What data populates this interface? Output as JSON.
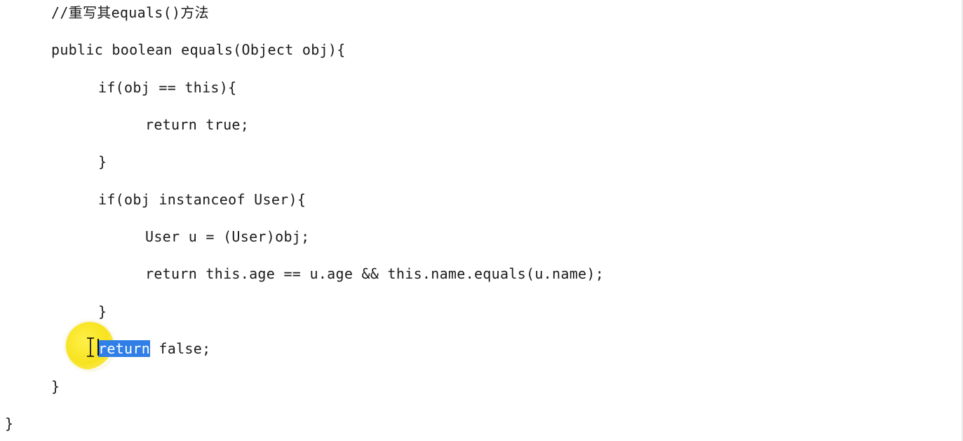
{
  "editor": {
    "lines": [
      {
        "id": "comment",
        "text": "//重写其equals()方法"
      },
      {
        "id": "method-signature",
        "text": "public boolean equals(Object obj){"
      },
      {
        "id": "if-same",
        "text": "if(obj == this){"
      },
      {
        "id": "return-true",
        "text": "return true;"
      },
      {
        "id": "close-if-same",
        "text": "}"
      },
      {
        "id": "if-instanceof",
        "text": "if(obj instanceof User){"
      },
      {
        "id": "cast",
        "text": "User u = (User)obj;"
      },
      {
        "id": "return-compare",
        "text": "return this.age == u.age && this.name.equals(u.name);"
      },
      {
        "id": "close-if-instanceof",
        "text": "}"
      },
      {
        "id": "return-false-keyword",
        "text": "return"
      },
      {
        "id": "return-false-rest",
        "text": " false;"
      },
      {
        "id": "close-method",
        "text": "}"
      },
      {
        "id": "close-class",
        "text": "}"
      }
    ]
  },
  "colors": {
    "selection": "#2f7fe6",
    "cursor_highlight": "#f7e31f",
    "text": "#1a1a1a"
  },
  "icons": {
    "cursor": "text-cursor-ibeam-icon"
  }
}
